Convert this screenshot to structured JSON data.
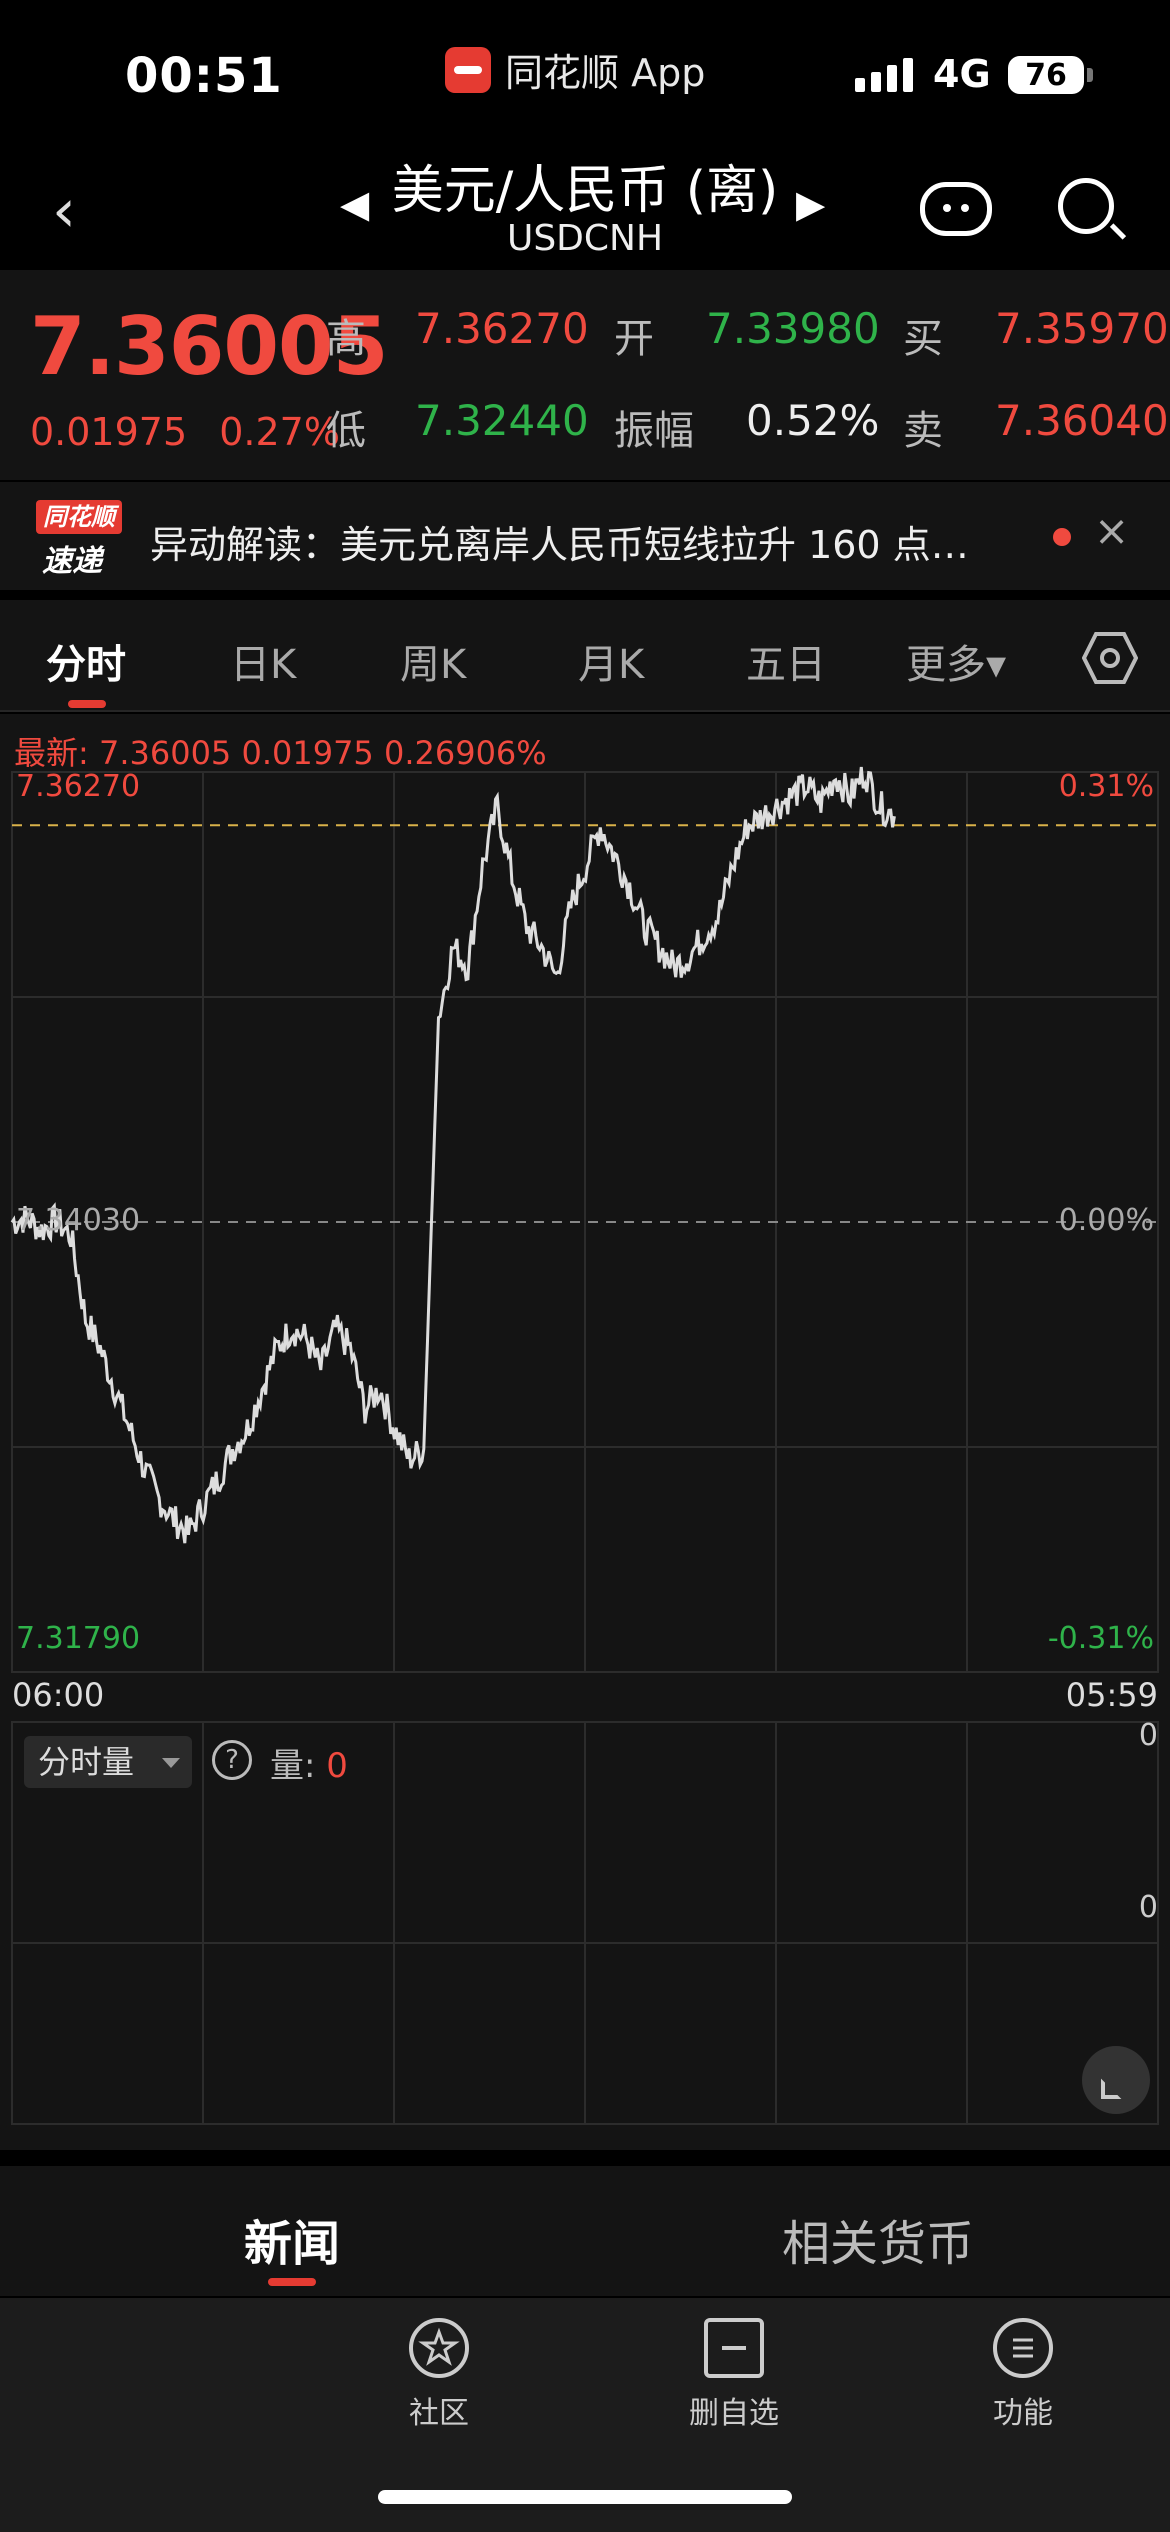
{
  "status": {
    "time": "00:51",
    "app_label": "同花顺 App",
    "network": "4G",
    "battery": "76"
  },
  "nav": {
    "title": "美元/人民币 (离)",
    "subtitle": "USDCNH",
    "prev": "◀",
    "next": "▶",
    "back": "‹"
  },
  "quote": {
    "price": "7.36005",
    "change": "0.01975",
    "change_pct": "0.27%",
    "high_label": "高",
    "high": "7.36270",
    "open_label": "开",
    "open": "7.33980",
    "buy_label": "买",
    "buy": "7.35970",
    "low_label": "低",
    "low": "7.32440",
    "amp_label": "振幅",
    "amplitude": "0.52%",
    "sell_label": "卖",
    "sell": "7.36040"
  },
  "banner": {
    "badge_top": "同花顺",
    "badge_bottom": "速递",
    "text": "异动解读：美元兑离岸人民币短线拉升 160 点…",
    "close": "×"
  },
  "tabs": [
    "分时",
    "日K",
    "周K",
    "月K",
    "五日",
    "更多▾"
  ],
  "chart": {
    "legend": "最新: 7.36005  0.01975  0.26906%",
    "top_price": "7.36270",
    "top_pct": "0.31%",
    "mid_price": "7.34030",
    "mid_pct": "0.00%",
    "bottom_price": "7.31790",
    "bottom_pct": "-0.31%",
    "time_start": "06:00",
    "time_end": "05:59"
  },
  "chart_data": {
    "type": "line",
    "ylim": [
      7.3179,
      7.3627
    ],
    "x": [
      "06:00",
      "05:59"
    ],
    "series": [
      {
        "values": [
          7.3403,
          7.3405,
          7.3399,
          7.3404,
          7.3396,
          7.3355,
          7.334,
          7.332,
          7.33,
          7.328,
          7.3265,
          7.3255,
          7.3248,
          7.3262,
          7.3275,
          7.329,
          7.33,
          7.332,
          7.334,
          7.335,
          7.3345,
          7.333,
          7.335,
          7.334,
          7.331,
          7.332,
          7.33,
          7.3285,
          7.329,
          7.3505,
          7.354,
          7.353,
          7.358,
          7.361,
          7.3575,
          7.355,
          7.354,
          7.3525,
          7.356,
          7.358,
          7.36,
          7.3585,
          7.357,
          7.355,
          7.354,
          7.353,
          7.3535,
          7.3545,
          7.3555,
          7.358,
          7.36,
          7.3605,
          7.361,
          7.3615,
          7.362,
          7.3612,
          7.3625,
          7.3615,
          7.3627,
          7.361,
          7.3605
        ]
      }
    ]
  },
  "volume": {
    "selector": "分时量",
    "label": "量: ",
    "value": "0",
    "zero_top": "0",
    "zero_bottom": "0"
  },
  "bottom_tabs": {
    "news": "新闻",
    "related": "相关货币"
  },
  "toolbar": {
    "community": "社区",
    "remove": "删自选",
    "functions": "功能"
  },
  "colors": {
    "up": "#f04a3f",
    "down": "#2fb34a",
    "accent": "#e53b32",
    "line": "#dddddd"
  }
}
